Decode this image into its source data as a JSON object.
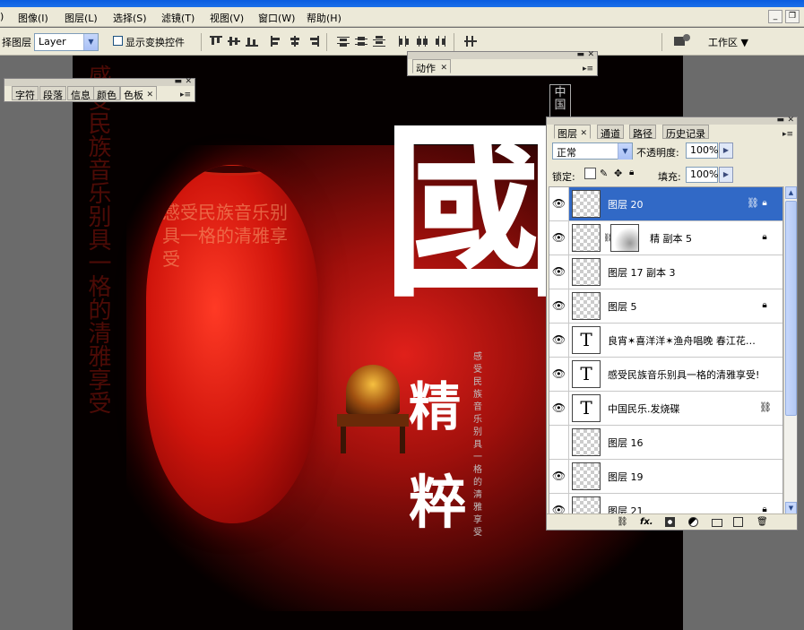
{
  "menu": {
    "items": [
      "图像(I)",
      "图层(L)",
      "选择(S)",
      "滤镜(T)",
      "视图(V)",
      "窗口(W)",
      "帮助(H)"
    ]
  },
  "options": {
    "select_label": "择图层",
    "select_value": "Layer",
    "transform_label": "显示变换控件",
    "workspace_label": "工作区"
  },
  "panel_char": {
    "tabs": [
      "字符",
      "段落",
      "信息",
      "颜色",
      "色板"
    ]
  },
  "panel_actions": {
    "tab": "动作"
  },
  "canvas_text": {
    "big_top": "國",
    "big_mid": "精",
    "big_bot": "粹",
    "slogan": "感受民族音乐别具一格的清雅享受",
    "stamp": "中国"
  },
  "layers_panel": {
    "tabs": [
      "图层",
      "通道",
      "路径",
      "历史记录"
    ],
    "blend_mode": "正常",
    "opacity_label": "不透明度:",
    "opacity_value": "100%",
    "lock_label": "锁定:",
    "fill_label": "填充:",
    "fill_value": "100%",
    "layers": [
      {
        "name": "图层 20",
        "kind": "pixel"
      },
      {
        "name": "精 副本 5",
        "kind": "mask"
      },
      {
        "name": "图层 17 副本 3",
        "kind": "pixel"
      },
      {
        "name": "图层 5",
        "kind": "pixel"
      },
      {
        "name": "良宵✶喜洋洋✶渔舟唱晚 春江花…",
        "kind": "text"
      },
      {
        "name": "感受民族音乐别具一格的清雅享受!",
        "kind": "text"
      },
      {
        "name": "中国民乐.发烧碟",
        "kind": "text"
      },
      {
        "name": "图层 16",
        "kind": "pixel"
      },
      {
        "name": "图层 19",
        "kind": "pixel"
      },
      {
        "name": "图层 21",
        "kind": "pixel"
      }
    ],
    "bottom_icons": [
      "link-icon",
      "fx-icon",
      "mask-icon",
      "adjustment-icon",
      "folder-icon",
      "new-layer-icon",
      "trash-icon"
    ]
  }
}
